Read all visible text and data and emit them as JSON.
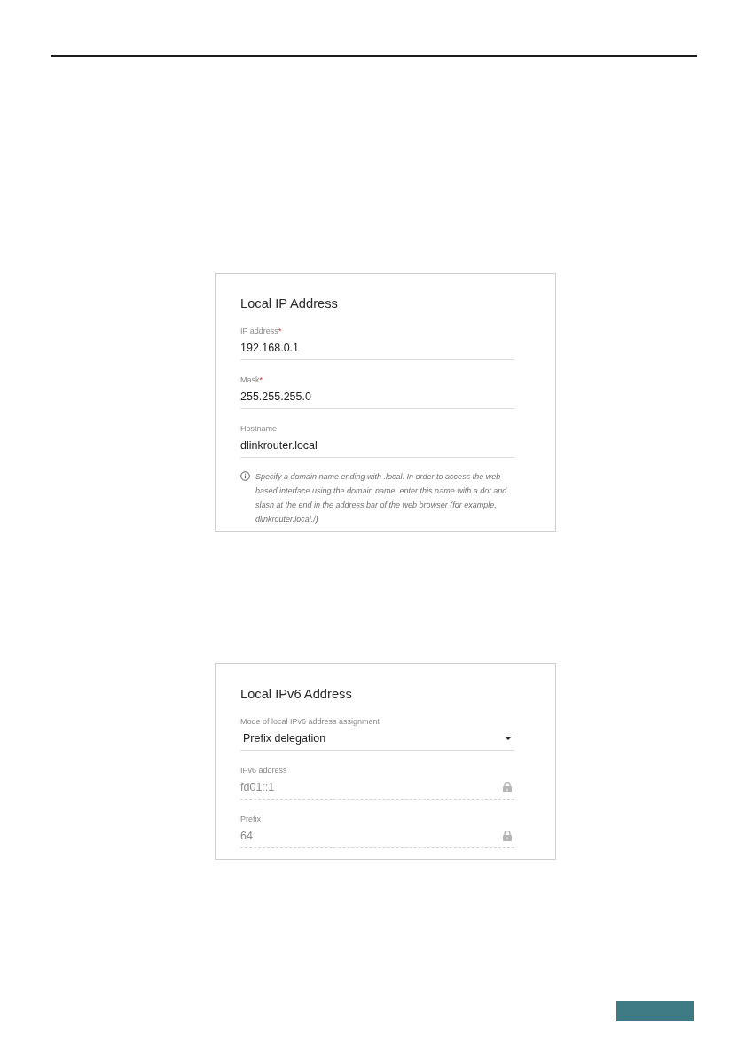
{
  "panels": [
    {
      "title": "Local IP Address",
      "fields": [
        {
          "kind": "text",
          "label": "IP address",
          "required_mark": "*",
          "value": "192.168.0.1",
          "locked": false
        },
        {
          "kind": "text",
          "label": "Mask",
          "required_mark": "*",
          "value": "255.255.255.0",
          "locked": false
        },
        {
          "kind": "text",
          "label": "Hostname",
          "value": "dlinkrouter.local",
          "locked": false
        }
      ],
      "note": "Specify a domain name ending with .local. In order to access the web-based interface using the domain name, enter this name with a dot and slash at the end in the address bar of the web browser (for example, dlinkrouter.local./)"
    },
    {
      "title": "Local IPv6 Address",
      "fields": [
        {
          "kind": "select",
          "label": "Mode of local IPv6 address assignment",
          "value": "Prefix delegation",
          "locked": false
        },
        {
          "kind": "text",
          "label": "IPv6 address",
          "value": "fd01::1",
          "locked": true
        },
        {
          "kind": "text",
          "label": "Prefix",
          "value": "64",
          "locked": true
        }
      ]
    }
  ]
}
